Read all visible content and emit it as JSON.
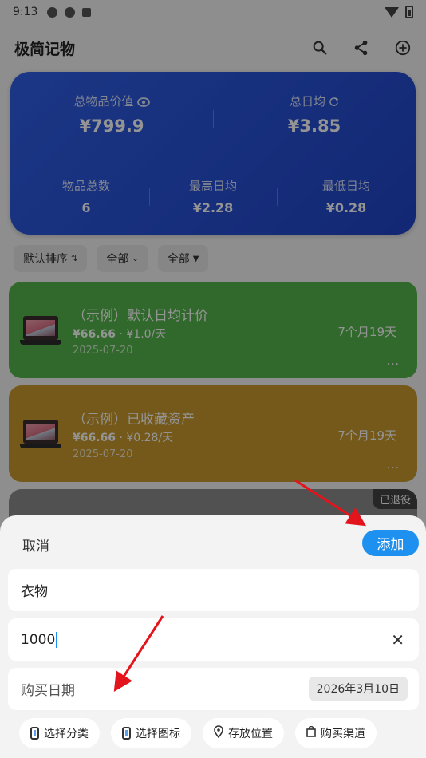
{
  "status_bar": {
    "time": "9:13"
  },
  "app": {
    "title": "极简记物",
    "actions": [
      "search-icon",
      "share-icon",
      "add-circle-icon"
    ]
  },
  "summary": {
    "total_value_label": "总物品价值",
    "total_value": "¥799.9",
    "daily_avg_label": "总日均",
    "daily_avg": "¥3.85",
    "item_count_label": "物品总数",
    "item_count": "6",
    "max_daily_label": "最高日均",
    "max_daily": "¥2.28",
    "min_daily_label": "最低日均",
    "min_daily": "¥0.28",
    "color": "#2a55dc"
  },
  "filters": [
    {
      "label": "默认排序",
      "icon": "sort-icon"
    },
    {
      "label": "全部",
      "icon": "chevron-down-icon"
    },
    {
      "label": "全部",
      "icon": "filter-icon"
    }
  ],
  "items": [
    {
      "name": "（示例）默认日均计价",
      "price": "¥66.66",
      "daily": " · ¥1.0/天",
      "date": "2025-07-20",
      "duration": "7个月19天",
      "more": "...",
      "color": "#54b64a"
    },
    {
      "name": "（示例）已收藏资产",
      "price": "¥66.66",
      "daily": " · ¥0.28/天",
      "date": "2025-07-20",
      "duration": "7个月19天",
      "more": "...",
      "color": "#c99a2f"
    },
    {
      "tag": "已退役",
      "color": "#8c8c8c"
    }
  ],
  "sheet": {
    "cancel_label": "取消",
    "add_label": "添加",
    "name_value": "衣物",
    "price_value": "1000",
    "date_label": "购买日期",
    "date_value": "2026年3月10日",
    "options": [
      {
        "label": "选择分类",
        "icon": "phone-icon"
      },
      {
        "label": "选择图标",
        "icon": "phone-icon"
      },
      {
        "label": "存放位置",
        "icon": "location-pin-icon"
      },
      {
        "label": "购买渠道",
        "icon": "bag-icon"
      }
    ],
    "accent": "#1e90f0"
  }
}
